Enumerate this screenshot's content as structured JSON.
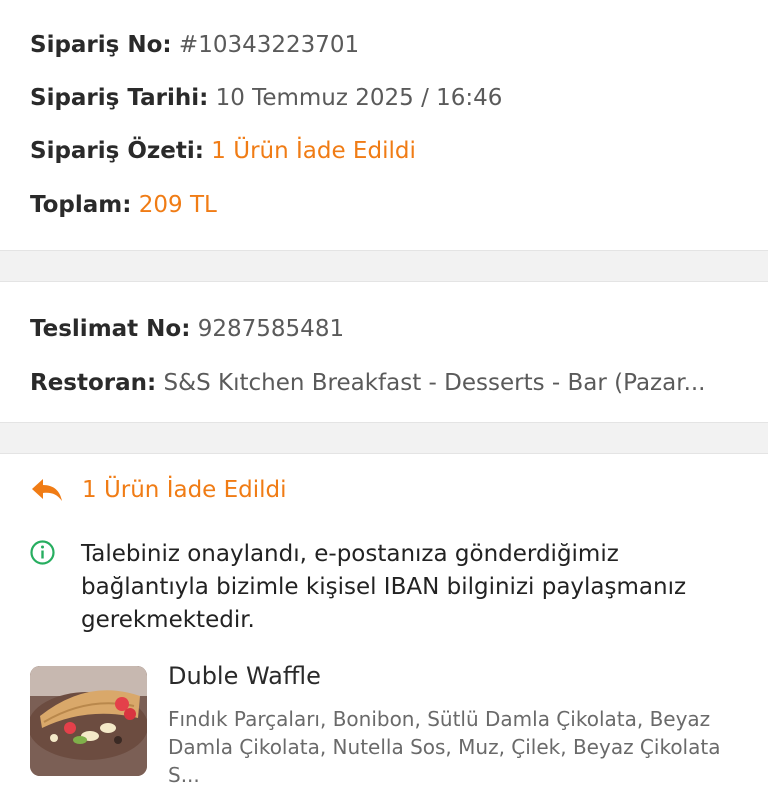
{
  "order": {
    "no_label": "Sipariş No:",
    "no_value": "#10343223701",
    "date_label": "Sipariş Tarihi:",
    "date_value": "10 Temmuz 2025 / 16:46",
    "summary_label": "Sipariş Özeti:",
    "summary_value": "1 Ürün İade Edildi",
    "total_label": "Toplam:",
    "total_value": "209 TL"
  },
  "delivery": {
    "no_label": "Teslimat No:",
    "no_value": "9287585481",
    "restaurant_label": "Restoran:",
    "restaurant_value": "S&S Kıtchen Breakfast - Desserts - Bar  (Pazar..."
  },
  "return_section": {
    "heading": "1 Ürün İade Edildi",
    "info_text": "Talebiniz onaylandı, e-postanıza gönderdiğimiz bağlantıyla bizimle kişisel IBAN bilginizi paylaşmanız gerekmektedir.",
    "icons": {
      "heading": "reply-arrow-icon",
      "info": "info-circle-icon"
    }
  },
  "product": {
    "name": "Duble Waffle",
    "description": "Fındık Parçaları, Bonibon, Sütlü Damla Çikolata, Beyaz Damla Çikolata, Nutella Sos, Muz, Çilek, Beyaz Çikolata S..."
  },
  "colors": {
    "accent": "#f07c15",
    "info_green": "#27ae60",
    "separator": "#f2f2f2"
  }
}
